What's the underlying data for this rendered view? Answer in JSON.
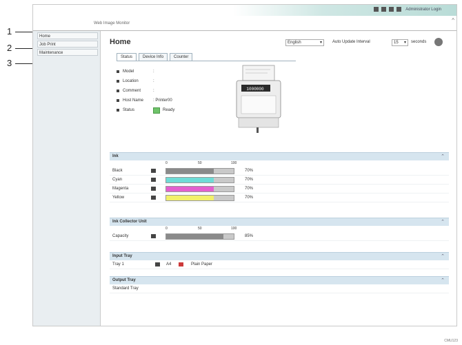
{
  "callouts": [
    "1",
    "2",
    "3"
  ],
  "topbar": {
    "links_label": "Administrator Login"
  },
  "app": {
    "title": "Web Image Monitor"
  },
  "sidebar": {
    "items": [
      {
        "label": "Home"
      },
      {
        "label": "Job Print"
      },
      {
        "label": "Maintenance"
      }
    ]
  },
  "header": {
    "page_title": "Home",
    "language": "English",
    "auto_update_label": "Auto Update Interval",
    "auto_update_value": "15",
    "seconds_label": "seconds"
  },
  "tabs": [
    {
      "label": "Status",
      "active": true
    },
    {
      "label": "Device Info",
      "active": false
    },
    {
      "label": "Counter",
      "active": false
    }
  ],
  "info": [
    {
      "label": "Model",
      "value": ":"
    },
    {
      "label": "Location",
      "value": ":"
    },
    {
      "label": "Comment",
      "value": ":"
    },
    {
      "label": "Host Name",
      "value": ": Printer00"
    },
    {
      "label": "Status",
      "value": "Ready"
    }
  ],
  "printer_display_text": "1000000",
  "ink": {
    "title": "Ink",
    "scale": [
      "0",
      "50",
      "100"
    ],
    "rows": [
      {
        "label": "Black",
        "level": 0.7,
        "value": "70%",
        "color": "#8a8a8a"
      },
      {
        "label": "Cyan",
        "level": 0.7,
        "value": "70%",
        "color": "#6fdbd6"
      },
      {
        "label": "Magenta",
        "level": 0.7,
        "value": "70%",
        "color": "#e35fcf"
      },
      {
        "label": "Yellow",
        "level": 0.7,
        "value": "70%",
        "color": "#f2f06a"
      }
    ]
  },
  "ink_collector": {
    "title": "Ink Collector Unit",
    "scale": [
      "0",
      "50",
      "100"
    ],
    "rows": [
      {
        "label": "Capacity",
        "level": 0.85,
        "value": "85%",
        "color": "#8a8a8a"
      }
    ]
  },
  "input_tray": {
    "title": "Input Tray",
    "rows": [
      {
        "label": "Tray 1",
        "size": "A4",
        "type": "Plain Paper"
      }
    ]
  },
  "output_tray": {
    "title": "Output Tray",
    "rows": [
      {
        "label": "Standard Tray"
      }
    ]
  },
  "figure_code": "CMU123"
}
